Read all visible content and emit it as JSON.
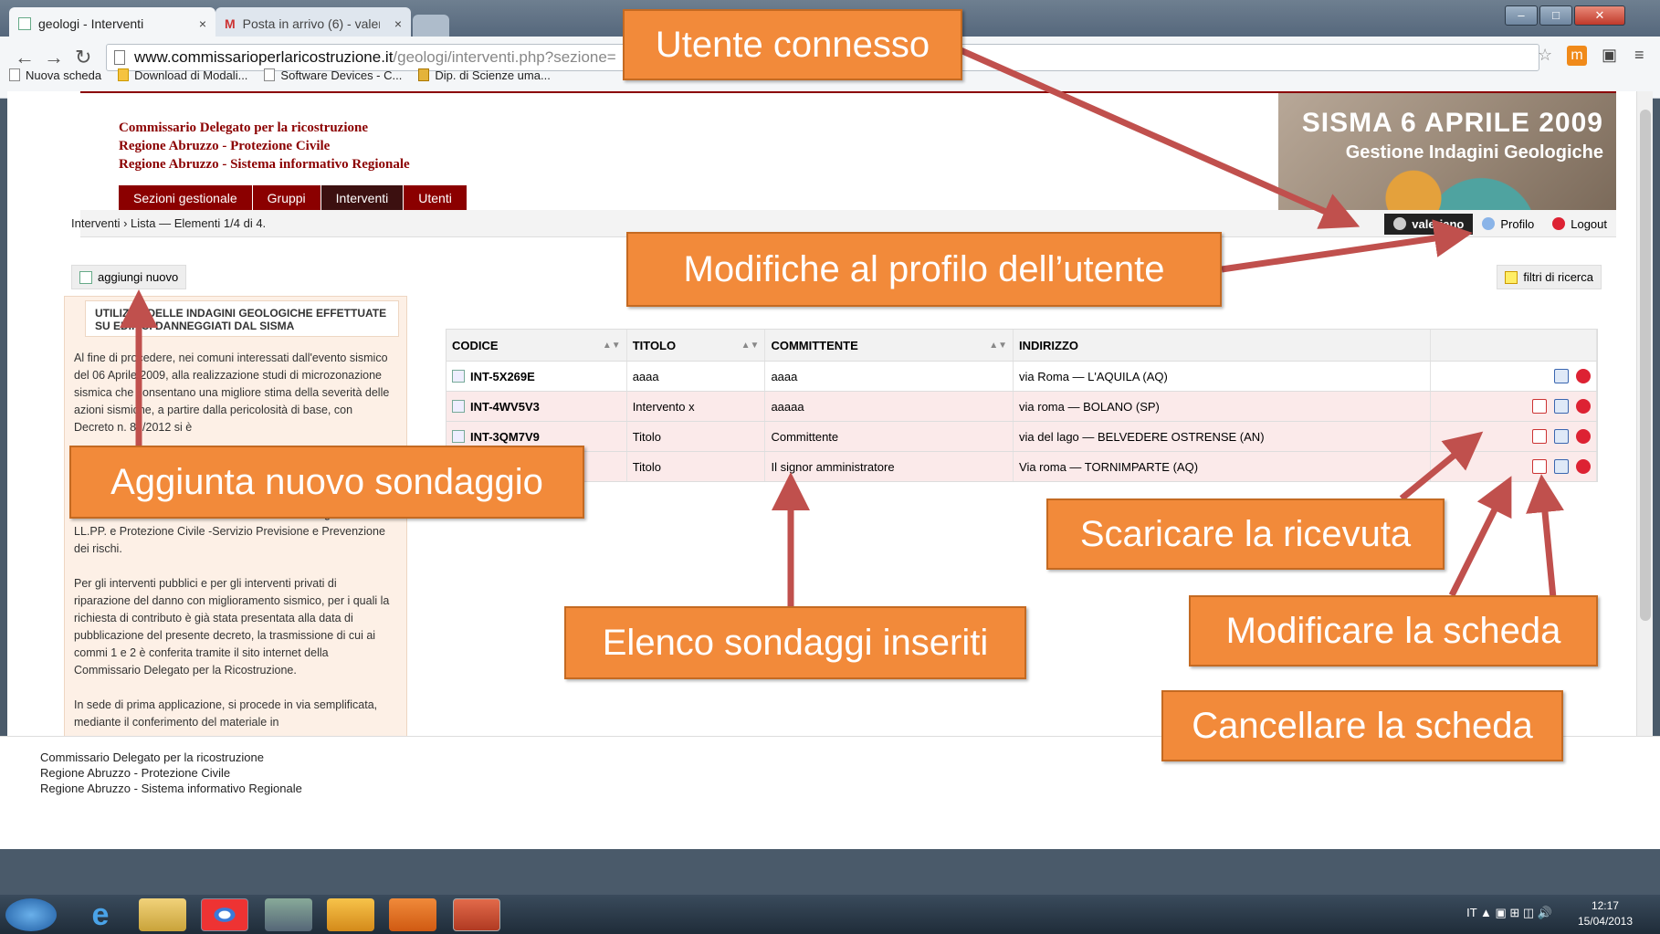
{
  "browser": {
    "tabs": [
      {
        "label": "geologi - Interventi",
        "active": true
      },
      {
        "label": "Posta in arrivo (6) - valeria",
        "active": false
      }
    ],
    "url": "www.commissarioperlaricostruzione.it",
    "url_rest": "/geologi/interventi.php?sezione=",
    "bookmarks": [
      "Nuova scheda",
      "Download di Modali...",
      "Software Devices - C...",
      "Dip. di Scienze uma..."
    ]
  },
  "site": {
    "org_lines": [
      "Commissario Delegato per la ricostruzione",
      "Regione Abruzzo - Protezione Civile",
      "Regione Abruzzo - Sistema informativo Regionale"
    ],
    "menu": [
      "Sezioni gestionale",
      "Gruppi",
      "Interventi",
      "Utenti"
    ],
    "banner_title": "SISMA 6 APRILE 2009",
    "banner_subtitle": "Gestione Indagini Geologiche",
    "breadcrumb": "Interventi › Lista — Elementi 1/4 di 4.",
    "user": "valeriano",
    "profile_label": "Profilo",
    "logout_label": "Logout",
    "add_label": "aggiungi nuovo",
    "filter_label": "filtri di ricerca"
  },
  "sidebar": {
    "title": "UTILIZZO DELLE INDAGINI GEOLOGICHE EFFETTUATE SU EDIFICI DANNEGGIATI DAL SISMA",
    "paragraphs": [
      "Al fine di procedere, nei comuni interessati dall'evento sismico del 06 Aprile 2009, alla realizzazione studi di microzonazione sismica che consentano una migliore stima della severità delle azioni sismiche, a partire dalla pericolosità di base, con Decreto n. 87/2012 si è",
      "cartacea e copia digitale (formato pdf) della Relazione Geologica - Geotecnica nonché del relativo rapporto contenente le risultanze delle indagini e prove, all'Amministrazione comunale e alla Direzione Regionale LL.PP. e Protezione Civile -Servizio Previsione e Prevenzione dei rischi.",
      "Per gli interventi pubblici e per gli interventi privati di riparazione del danno con miglioramento sismico, per i quali la richiesta di contributo è già stata presentata alla data di pubblicazione del presente decreto, la trasmissione di cui ai commi 1 e 2 è conferita tramite il sito internet della Commissario Delegato per la Ricostruzione.",
      "In sede di prima applicazione, si procede in via semplificata, mediante il conferimento del materiale in"
    ]
  },
  "table": {
    "headers": [
      "CODICE",
      "TITOLO",
      "COMMITTENTE",
      "INDIRIZZO"
    ],
    "rows": [
      {
        "codice": "INT-5X269E",
        "titolo": "aaaa",
        "committente": "aaaa",
        "indirizzo": "via Roma — L'AQUILA (AQ)"
      },
      {
        "codice": "INT-4WV5V3",
        "titolo": "Intervento x",
        "committente": "aaaaa",
        "indirizzo": "via roma — BOLANO (SP)"
      },
      {
        "codice": "INT-3QM7V9",
        "titolo": "Titolo",
        "committente": "Committente",
        "indirizzo": "via del lago — BELVEDERE OSTRENSE (AN)"
      },
      {
        "codice": "",
        "titolo": "Titolo",
        "committente": "Il signor amministratore",
        "indirizzo": "Via roma — TORNIMPARTE (AQ)"
      }
    ]
  },
  "footer": {
    "lines": [
      "Commissario Delegato per la ricostruzione",
      "Regione Abruzzo - Protezione Civile",
      "Regione Abruzzo - Sistema informativo Regionale"
    ]
  },
  "taskbar": {
    "lang": "IT",
    "time": "12:17",
    "date": "15/04/2013"
  },
  "callouts": {
    "user": "Utente connesso",
    "profile": "Modifiche al profilo dell’utente",
    "add": "Aggiunta nuovo sondaggio",
    "receipt": "Scaricare la ricevuta",
    "list": "Elenco sondaggi inseriti",
    "edit": "Modificare la scheda",
    "delete": "Cancellare la scheda"
  },
  "colors": {
    "callout": "#f28a3a",
    "arrow": "#c0504d",
    "brand": "#8b0000"
  }
}
